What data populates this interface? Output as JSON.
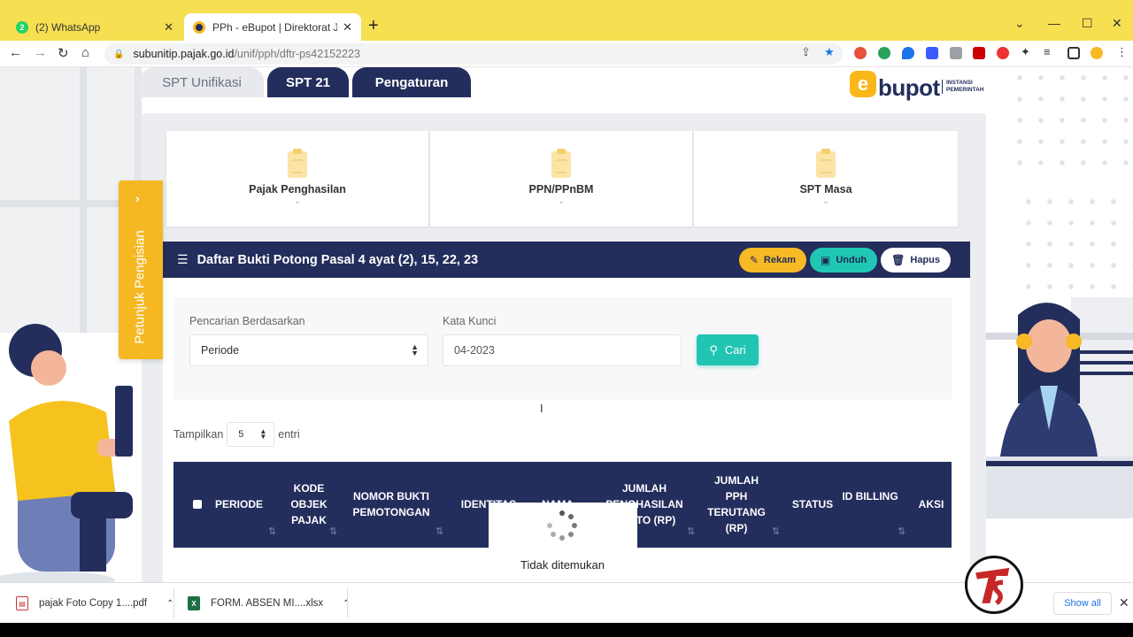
{
  "browser": {
    "tabs": [
      {
        "title": "(2) WhatsApp",
        "favicon": "whatsapp-icon"
      },
      {
        "title": "PPh - eBupot | Direktorat Jender",
        "favicon": "ebupot-favicon"
      }
    ],
    "url_host": "subunitip.pajak.go.id",
    "url_path": "/unif/pph/dftr-ps42152223"
  },
  "app": {
    "tabs": [
      "SPT Unifikasi",
      "SPT 21",
      "Pengaturan"
    ],
    "logo_e": "e",
    "logo_text": "bupot",
    "logo_instansi": "INSTANSI PEMERINTAH",
    "side_tab": "Petunjuk Pengisian",
    "cards": [
      "Pajak Penghasilan",
      "PPN/PPnBM",
      "SPT Masa"
    ],
    "list_title": "Daftar Bukti Potong Pasal 4 ayat (2), 15, 22, 23",
    "buttons": {
      "rekam": "Rekam",
      "unduh": "Unduh",
      "hapus": "Hapus",
      "cari": "Cari"
    },
    "search": {
      "by_label": "Pencarian Berdasarkan",
      "by_value": "Periode",
      "keyword_label": "Kata Kunci",
      "keyword_value": "04-2023"
    },
    "entries": {
      "prefix": "Tampilkan",
      "value": "5",
      "suffix": "entri"
    },
    "columns": [
      "PERIODE",
      "KODE OBJEK PAJAK",
      "NOMOR BUKTI PEMOTONGAN",
      "IDENTITAS",
      "NAMA",
      "JUMLAH PENGHASILAN BRUTO (RP)",
      "JUMLAH PPH TERUTANG (RP)",
      "STATUS",
      "ID BILLING",
      "AKSI"
    ],
    "empty_message": "Tidak ditemukan"
  },
  "downloads": [
    {
      "name": "pajak Foto Copy 1....pdf",
      "type": "pdf"
    },
    {
      "name": "FORM. ABSEN MI....xlsx",
      "type": "xlsx"
    }
  ],
  "show_all": "Show all",
  "colors": {
    "navy": "#232e5c",
    "yellow": "#f7b924",
    "teal": "#22c4b4",
    "chrome": "#f7df52"
  }
}
